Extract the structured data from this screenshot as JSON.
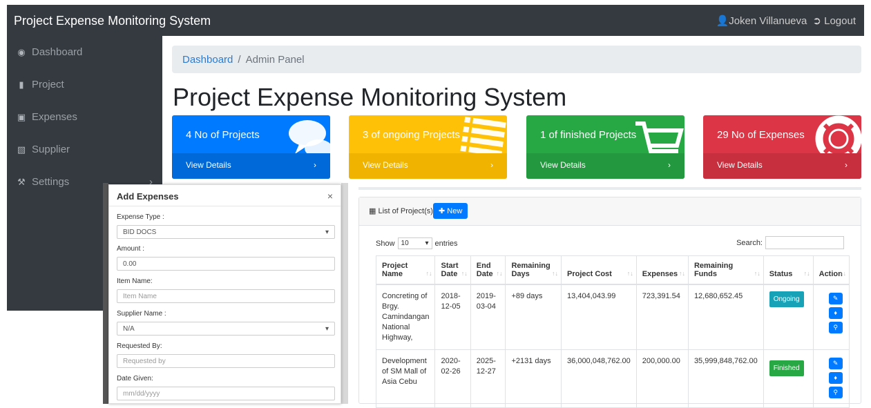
{
  "app": {
    "title": "Project Expense Monitoring System",
    "user": "Joken Villanueva",
    "logout": "Logout"
  },
  "sidebar": {
    "items": [
      {
        "label": "Dashboard",
        "icon": "tachometer-icon"
      },
      {
        "label": "Project",
        "icon": "book-icon"
      },
      {
        "label": "Expenses",
        "icon": "money-icon"
      },
      {
        "label": "Supplier",
        "icon": "contact-icon"
      },
      {
        "label": "Settings",
        "icon": "wrench-icon"
      }
    ]
  },
  "breadcrumb": {
    "home": "Dashboard",
    "current": "Admin Panel"
  },
  "page_title": "Project Expense Monitoring System",
  "cards": [
    {
      "text": "4 No of Projects",
      "link": "View Details",
      "color": "#007bff",
      "footer": "#0069d9",
      "icon": "comments-icon"
    },
    {
      "text": "3 of ongoing Projects",
      "link": "View Details",
      "color": "#ffc107",
      "footer": "#f0b400",
      "icon": "list-icon"
    },
    {
      "text": "1 of finished Projects",
      "link": "View Details",
      "color": "#28a745",
      "footer": "#23983e",
      "icon": "cart-icon"
    },
    {
      "text": "29 No of Expenses",
      "link": "View Details",
      "color": "#dc3545",
      "footer": "#c82f3e",
      "icon": "life-ring-icon"
    }
  ],
  "projects_panel": {
    "header": "List of Project(s)",
    "new_button": "New",
    "show_label": "Show",
    "entries_value": "10",
    "entries_label": "entries",
    "search_label": "Search:",
    "columns": [
      "Project Name",
      "Start Date",
      "End Date",
      "Remaining Days",
      "Project Cost",
      "Expenses",
      "Remaining Funds",
      "Status",
      "Action"
    ],
    "rows": [
      {
        "name": "Concreting of Brgy. Camindangan National Highway,",
        "start": "2018-12-05",
        "end": "2019-03-04",
        "remaining_days": "+89 days",
        "cost": "13,404,043.99",
        "expenses": "723,391.54",
        "remaining_funds": "12,680,652.45",
        "status": "Ongoing",
        "status_color": "#17a2b8"
      },
      {
        "name": "Development of SM Mall of Asia Cebu",
        "start": "2020-02-26",
        "end": "2025-12-27",
        "remaining_days": "+2131 days",
        "cost": "36,000,048,762.00",
        "expenses": "200,000.00",
        "remaining_funds": "35,999,848,762.00",
        "status": "Finished",
        "status_color": "#28a745"
      }
    ]
  },
  "modal": {
    "title": "Add Expenses",
    "close": "×",
    "expense_type_label": "Expense Type :",
    "expense_type_value": "BID DOCS",
    "amount_label": "Amount :",
    "amount_value": "0.00",
    "item_name_label": "Item Name:",
    "item_name_placeholder": "Item Name",
    "supplier_label": "Supplier Name :",
    "supplier_value": "N/A",
    "requested_by_label": "Requested By:",
    "requested_by_placeholder": "Requested by",
    "date_given_label": "Date Given:",
    "date_given_placeholder": "mm/dd/yyyy"
  }
}
